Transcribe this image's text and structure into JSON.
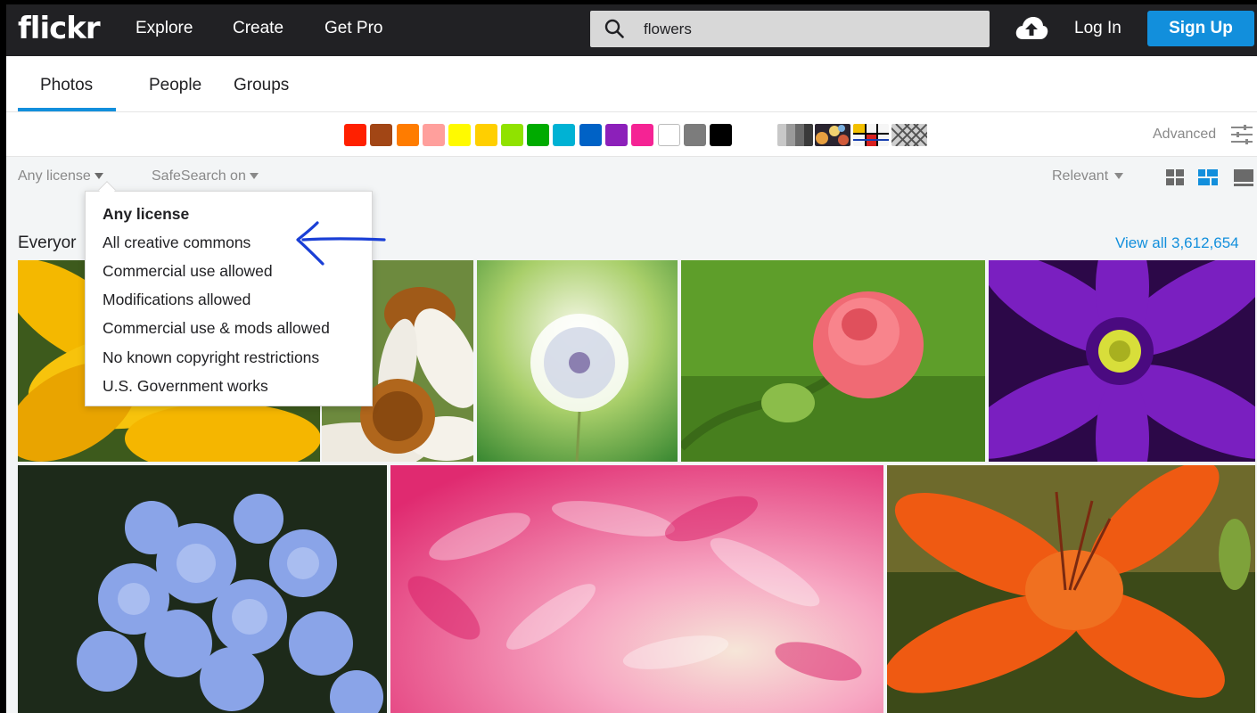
{
  "header": {
    "logo": "flickr",
    "nav": [
      "Explore",
      "Create",
      "Get Pro"
    ],
    "search": {
      "value": "flowers",
      "placeholder": ""
    },
    "login": "Log In",
    "signup": "Sign Up"
  },
  "tabs": {
    "items": [
      "Photos",
      "People",
      "Groups"
    ],
    "active": "Photos"
  },
  "colors": {
    "swatches": [
      "#ff2000",
      "#a24615",
      "#ff7c00",
      "#ff9f9c",
      "#fffa00",
      "#ffcf00",
      "#90e200",
      "#00ab00",
      "#00b2d4",
      "#0062c6",
      "#8c20ba",
      "#f52394",
      "#ffffff",
      "#7c7c7c",
      "#000000"
    ],
    "styles": [
      "black-and-white",
      "shallow-depth-of-field",
      "minimalist",
      "patterns"
    ],
    "advanced_label": "Advanced",
    "accent": "#128fdc"
  },
  "filters": {
    "license": "Any license",
    "safesearch": "SafeSearch on",
    "sort": "Relevant"
  },
  "license_menu": {
    "selected": "Any license",
    "items": [
      "Any license",
      "All creative commons",
      "Commercial use allowed",
      "Modifications allowed",
      "Commercial use & mods allowed",
      "No known copyright restrictions",
      "U.S. Government works"
    ]
  },
  "results": {
    "section_title": "Everyone's photos",
    "section_title_visible": "Everyor",
    "view_all": "View all 3,612,654"
  }
}
